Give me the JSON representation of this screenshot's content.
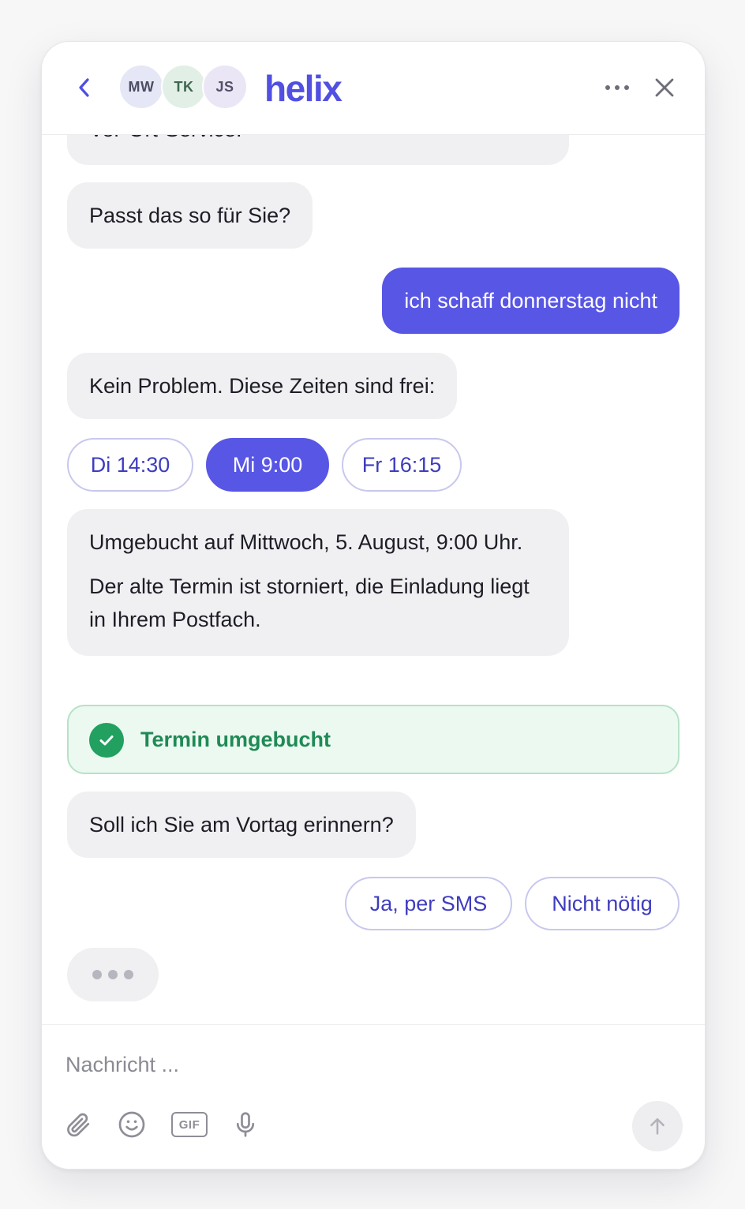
{
  "header": {
    "back_icon": "chevron-left-icon",
    "avatars": [
      "MW",
      "TK",
      "JS"
    ],
    "brand": "helix",
    "more_icon": "more-horizontal-icon",
    "close_icon": "close-icon"
  },
  "messages": {
    "clipped_text": "Vor-Ort-Service.",
    "bot_question": "Passt das so für Sie?",
    "user_message": "ich schaff donnerstag nicht",
    "bot_times_intro": "Kein Problem. Diese Zeiten sind frei:",
    "time_slots": [
      "Di 14:30",
      "Mi 9:00",
      "Fr 16:15"
    ],
    "selected_slot": "Mi 9:00",
    "bot_confirmation": {
      "line1": "Umgebucht auf Mittwoch, 5. August, 9:00 Uhr.",
      "line2": "Der alte Termin ist storniert, die Einladung liegt in Ihrem Postfach."
    },
    "status_label": "Termin umgebucht",
    "bot_reminder_question": "Soll ich Sie am Vortag erinnern?",
    "reply_options": [
      "Ja, per SMS",
      "Nicht nötig"
    ]
  },
  "composer": {
    "placeholder": "Nachricht ...",
    "tools": [
      "paperclip-icon",
      "smile-icon",
      "gif-icon",
      "microphone-icon"
    ],
    "gif_label": "GIF",
    "send_icon": "arrow-up-icon"
  },
  "colors": {
    "accent": "#5856e5",
    "success": "#22a05f",
    "bubble_bot": "#f0f0f2"
  }
}
